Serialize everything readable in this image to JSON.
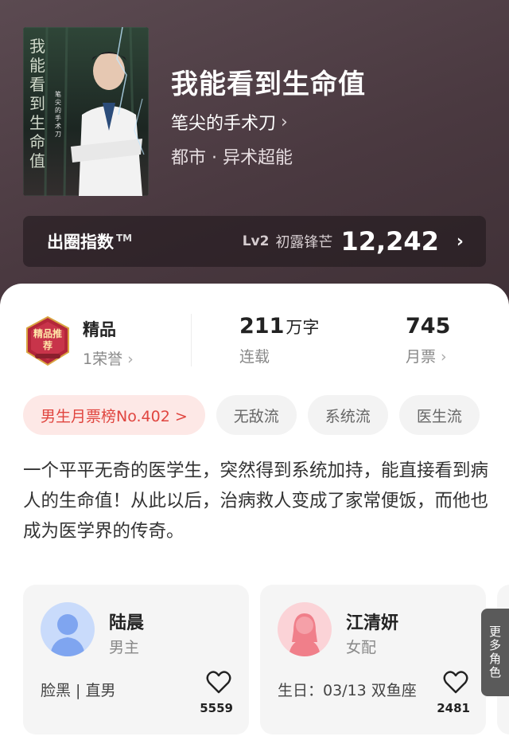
{
  "book": {
    "title": "我能看到生命值",
    "author": "笔尖的手术刀",
    "genre": "都市 · 异术超能",
    "cover_text": "我能看到生命值",
    "cover_author": "笔尖的手术刀"
  },
  "index_bar": {
    "label": "出圈指数",
    "tm": "TM",
    "level": "Lv2",
    "level_name": "初露锋芒",
    "score": "12,242"
  },
  "stats": {
    "quality": {
      "label": "精品",
      "honor": "1荣誉",
      "badge_text": "精品推荐"
    },
    "words": {
      "value": "211",
      "unit": "万字",
      "status": "连载"
    },
    "tickets": {
      "value": "745",
      "label": "月票"
    }
  },
  "tags": [
    {
      "label": "男生月票榜No.402 >",
      "type": "rank"
    },
    {
      "label": "无敌流",
      "type": "normal"
    },
    {
      "label": "系统流",
      "type": "normal"
    },
    {
      "label": "医生流",
      "type": "normal"
    }
  ],
  "synopsis": "一个平平无奇的医学生，突然得到系统加持，能直接看到病人的生命值！从此以后，治病救人变成了家常便饭，而他也成为医学界的传奇。",
  "characters": [
    {
      "name": "陆晨",
      "role": "男主",
      "desc": "脸黑 | 直男",
      "likes": "5559",
      "avatar": "male-avatar",
      "color": "#7fa5f0"
    },
    {
      "name": "江清妍",
      "role": "女配",
      "desc": "生日：03/13 双鱼座",
      "likes": "2481",
      "avatar": "female-avatar",
      "color": "#f07f8a"
    }
  ],
  "more_roles": "更多角色",
  "colors": {
    "accent": "#e0453f",
    "hero_bg": "#4a3b42"
  }
}
